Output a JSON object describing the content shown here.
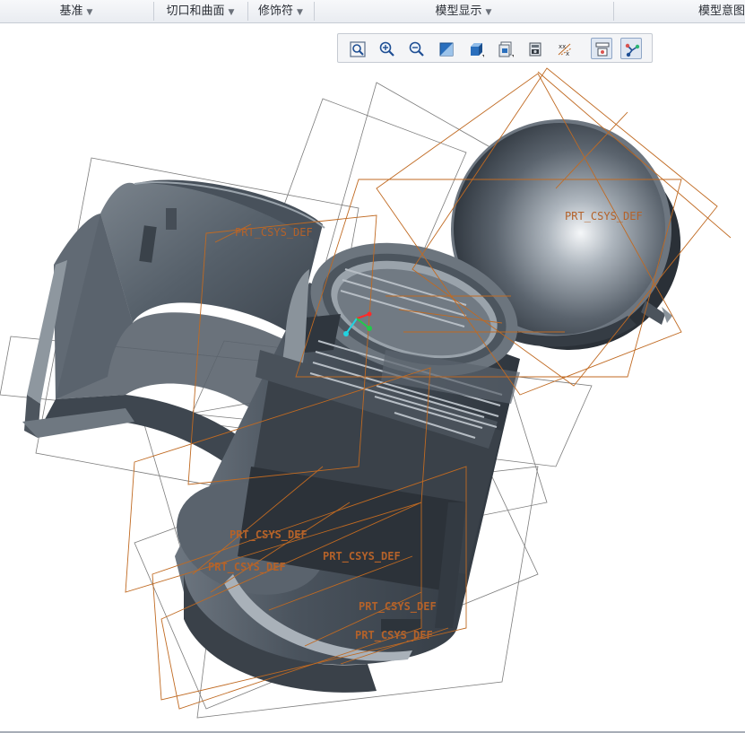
{
  "ribbon": {
    "groups": [
      {
        "label": "基准",
        "icon": "chevron-down-icon"
      },
      {
        "label": "切口和曲面",
        "icon": "chevron-down-icon"
      },
      {
        "label": "修饰符",
        "icon": "chevron-down-icon"
      },
      {
        "label": "模型显示",
        "icon": "chevron-down-icon"
      },
      {
        "label": "模型意图"
      }
    ],
    "arrow_glyph": "▼"
  },
  "view_toolbar": {
    "buttons": [
      {
        "name": "refit-icon"
      },
      {
        "name": "zoom-in-icon"
      },
      {
        "name": "zoom-out-icon"
      },
      {
        "name": "repaint-icon"
      },
      {
        "name": "display-style-icon"
      },
      {
        "name": "saved-orientations-icon"
      },
      {
        "name": "view-manager-icon"
      },
      {
        "name": "datum-display-filters-icon"
      },
      {
        "name": "annotation-display-icon",
        "active": true
      },
      {
        "name": "spin-center-icon",
        "active": true
      }
    ]
  },
  "viewport": {
    "labels": {
      "csys_1": "PRT_CSYS_DEF",
      "csys_2": "PRT_CSYS_DEF",
      "csys_3": "PRT_CSYS_DEF",
      "csys_4": "PRT_CSYS_DEF",
      "csys_5": "PRT_CSYS_DEF",
      "csys_6": "PRT_CSYS_DEF",
      "csys_7": "PRT_CSYS_DEF"
    },
    "colors": {
      "datum_orange": "#c06a22",
      "datum_gray": "#7c7c7c",
      "model_dark": "#3e464f",
      "model_mid": "#5d6670",
      "model_light": "#a9b1b9"
    }
  }
}
